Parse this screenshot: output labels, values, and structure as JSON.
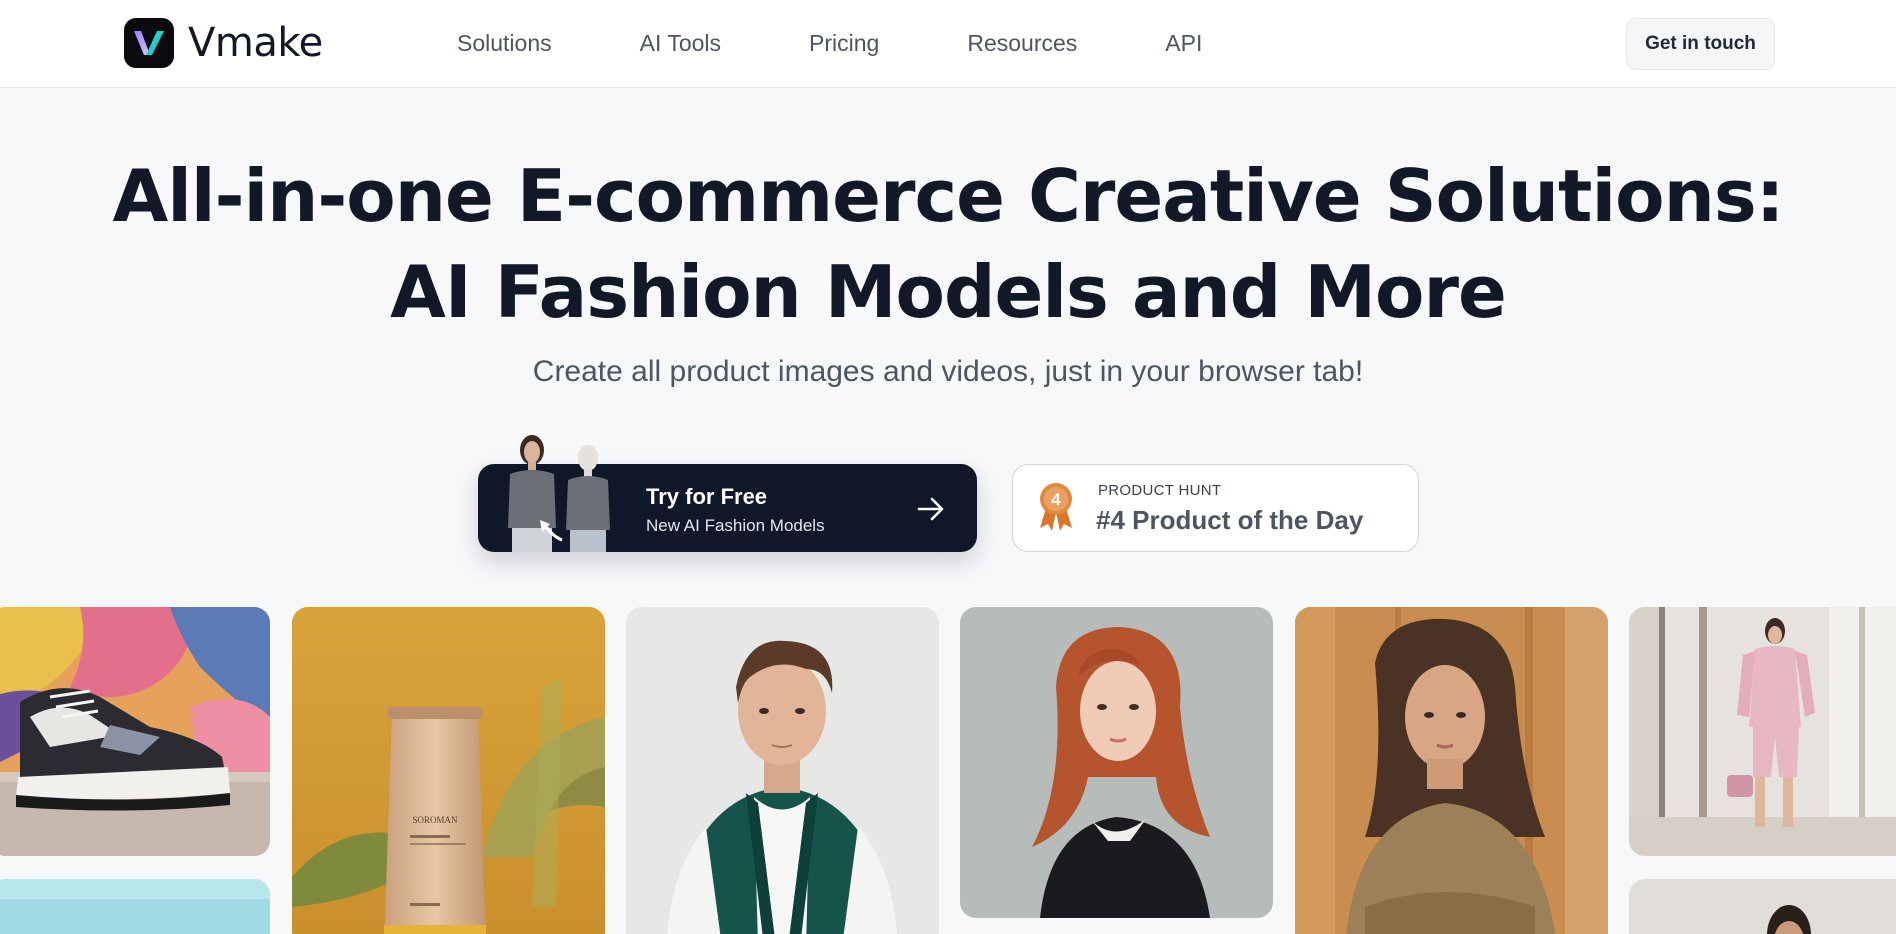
{
  "header": {
    "brand": "Vmake",
    "nav": [
      {
        "label": "Solutions"
      },
      {
        "label": "AI Tools"
      },
      {
        "label": "Pricing"
      },
      {
        "label": "Resources"
      },
      {
        "label": "API"
      }
    ],
    "cta_label": "Get in touch"
  },
  "hero": {
    "title_line1": "All-in-one E-commerce Creative Solutions:",
    "title_line2": "AI Fashion Models and More",
    "subtitle": "Create all product images and videos, just in your browser tab!"
  },
  "try_button": {
    "title": "Try for Free",
    "subtitle": "New AI Fashion Models"
  },
  "product_hunt": {
    "label": "PRODUCT HUNT",
    "title": "#4 Product of the Day",
    "rank": "4"
  },
  "gallery": {
    "tube_brand": "SOROMAN"
  },
  "colors": {
    "primary": "#0f172a",
    "background": "#f7f8fa",
    "medal": "#e08a3c"
  }
}
